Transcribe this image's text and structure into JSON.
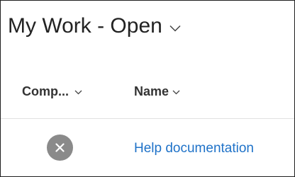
{
  "view": {
    "title": "My Work - Open",
    "chevron_icon": "chevron-down-icon"
  },
  "columns": [
    {
      "label": "Comp...",
      "icon": "chevron-down-icon"
    },
    {
      "label": "Name",
      "icon": "chevron-down-icon"
    }
  ],
  "rows": [
    {
      "status_icon": "close-circle-icon",
      "name": "Help documentation"
    }
  ],
  "colors": {
    "title_text": "#222222",
    "header_text": "#333333",
    "link": "#1f72c8",
    "status_icon_bg": "#8a8a8a",
    "divider": "#e1e1e1"
  }
}
